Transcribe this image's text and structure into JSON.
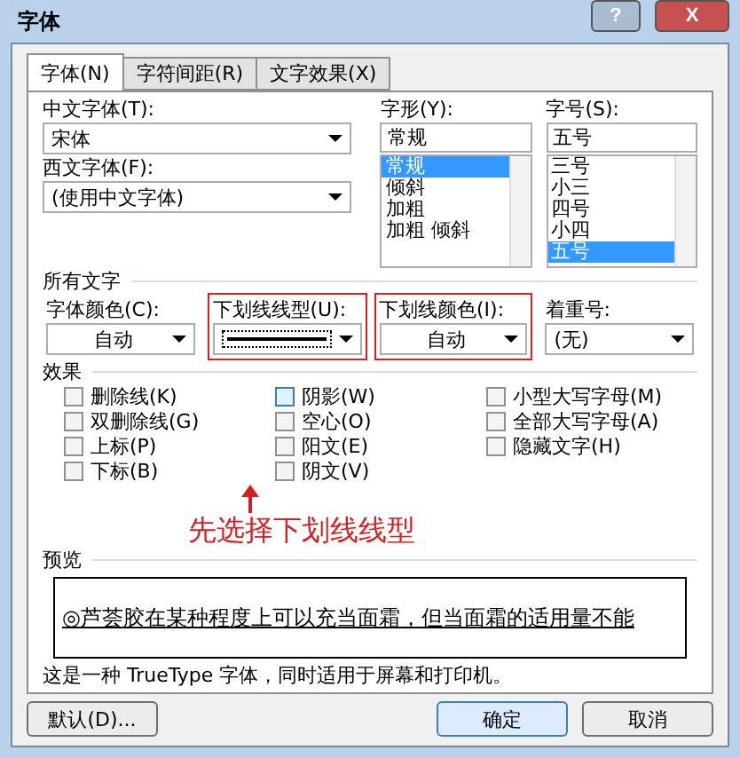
{
  "window": {
    "title": "字体",
    "help_button": "?",
    "close_button": "X"
  },
  "tabs": [
    {
      "label": "字体(N)",
      "selected": true
    },
    {
      "label": "字符间距(R)",
      "selected": false
    },
    {
      "label": "文字效果(X)",
      "selected": false
    }
  ],
  "chinese_font": {
    "label": "中文字体(T):",
    "value": "宋体"
  },
  "western_font": {
    "label": "西文字体(F):",
    "value": "(使用中文字体)"
  },
  "style": {
    "label": "字形(Y):",
    "value": "常规",
    "items": [
      {
        "label": "常规",
        "selected": true
      },
      {
        "label": "倾斜",
        "selected": false
      },
      {
        "label": "加粗",
        "selected": false
      },
      {
        "label": "加粗 倾斜",
        "selected": false
      }
    ]
  },
  "size": {
    "label": "字号(S):",
    "value": "五号",
    "items": [
      {
        "label": "三号",
        "selected": false
      },
      {
        "label": "小三",
        "selected": false
      },
      {
        "label": "四号",
        "selected": false
      },
      {
        "label": "小四",
        "selected": false
      },
      {
        "label": "五号",
        "selected": true
      }
    ]
  },
  "all_text": {
    "title": "所有文字",
    "fields": [
      {
        "kind": "text",
        "label": "字体颜色(C):",
        "value": "自动",
        "annotated": false
      },
      {
        "kind": "line",
        "label": "下划线线型(U):",
        "annotated": true
      },
      {
        "kind": "text",
        "label": "下划线颜色(I):",
        "value": "自动",
        "annotated": true
      },
      {
        "kind": "left",
        "label": "着重号:",
        "value": "(无)",
        "annotated": false
      }
    ]
  },
  "effects": {
    "title": "效果",
    "columns": [
      [
        {
          "label": "删除线(K)",
          "checked": false,
          "highlighted": false
        },
        {
          "label": "双删除线(G)",
          "checked": false,
          "highlighted": false
        },
        {
          "label": "上标(P)",
          "checked": false,
          "highlighted": false
        },
        {
          "label": "下标(B)",
          "checked": false,
          "highlighted": false
        }
      ],
      [
        {
          "label": "阴影(W)",
          "checked": false,
          "highlighted": true
        },
        {
          "label": "空心(O)",
          "checked": false,
          "highlighted": false
        },
        {
          "label": "阳文(E)",
          "checked": false,
          "highlighted": false
        },
        {
          "label": "阴文(V)",
          "checked": false,
          "highlighted": false
        }
      ],
      [
        {
          "label": "小型大写字母(M)",
          "checked": false,
          "highlighted": false
        },
        {
          "label": "全部大写字母(A)",
          "checked": false,
          "highlighted": false
        },
        {
          "label": "隐藏文字(H)",
          "checked": false,
          "highlighted": false
        }
      ]
    ]
  },
  "annotation": "先选择下划线线型",
  "preview": {
    "title": "预览",
    "sample": "◎芦荟胶在某种程度上可以充当面霜，但当面霜的适用量不能",
    "note": "这是一种 TrueType 字体，同时适用于屏幕和打印机。"
  },
  "buttons": {
    "default": "默认(D)...",
    "ok": "确定",
    "cancel": "取消"
  }
}
